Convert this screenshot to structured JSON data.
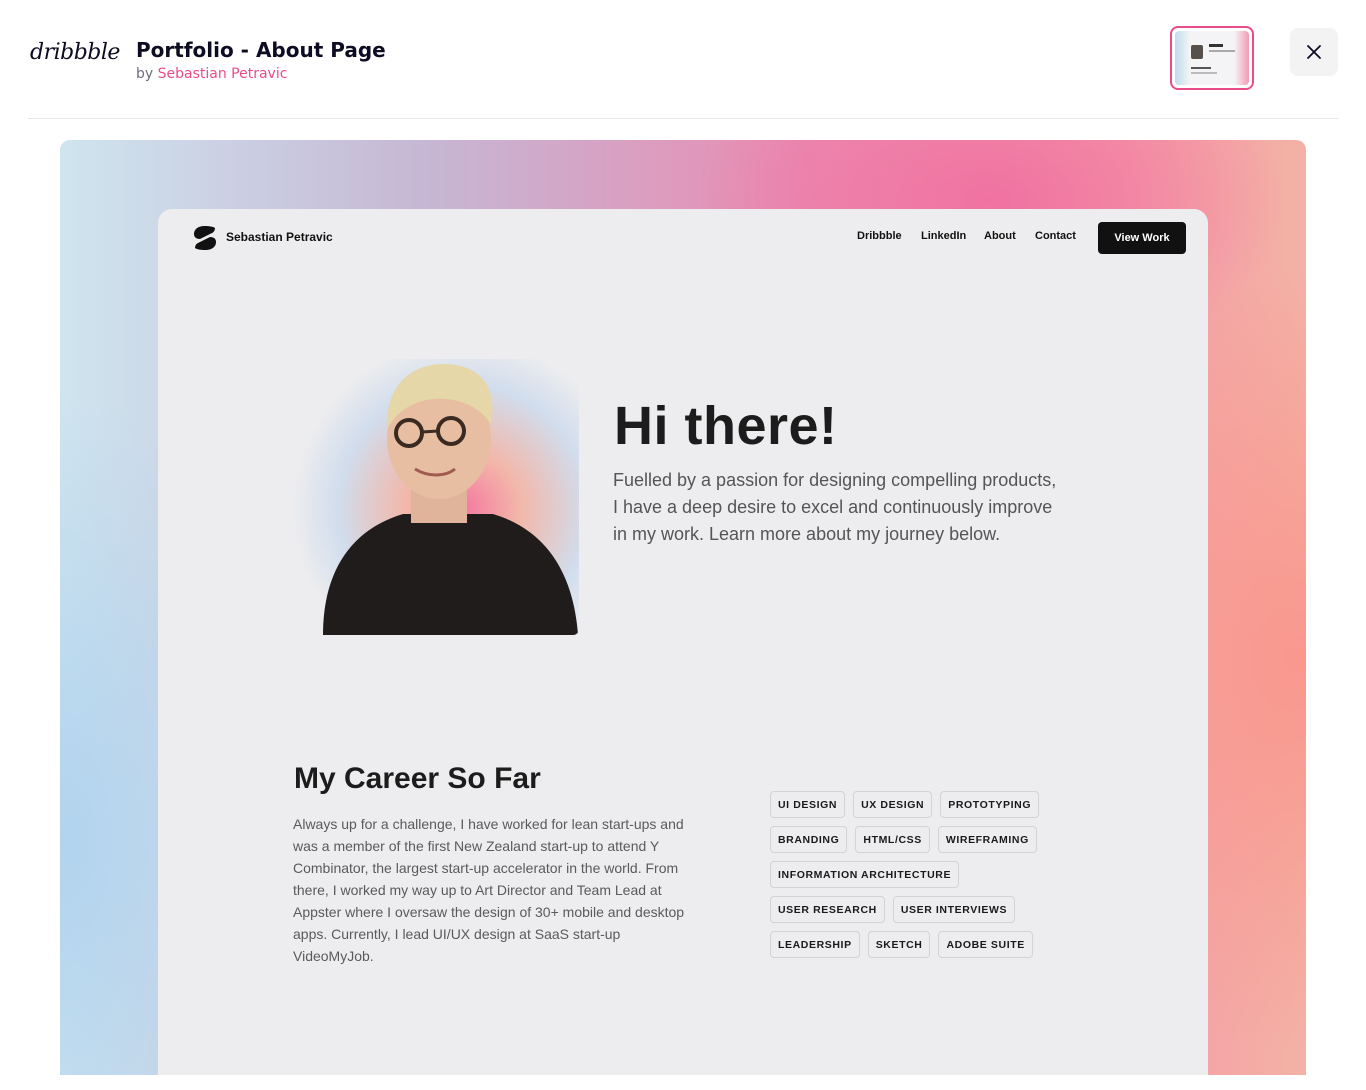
{
  "header": {
    "logo_text": "dribbble",
    "shot_title": "Portfolio - About Page",
    "by_prefix": "by",
    "author": "Sebastian Petravic"
  },
  "shot": {
    "site_name": "Sebastian Petravic",
    "nav": [
      "Dribbble",
      "LinkedIn",
      "About",
      "Contact"
    ],
    "cta": "View Work",
    "hero_title": "Hi there!",
    "hero_text": "Fuelled by a passion for designing compelling products, I have a deep desire to excel and continuously improve in my work. Learn more about my journey below.",
    "career_title": "My Career So Far",
    "career_text": "Always up for a challenge, I have worked for lean start-ups and was a member of the first New Zealand start-up to attend Y Combinator, the largest start-up accelerator in the world. From there, I worked my way up to Art Director and Team Lead at Appster where I oversaw the design of 30+ mobile and desktop apps. Currently, I lead UI/UX design at SaaS start-up VideoMyJob.",
    "tags": [
      [
        "UI DESIGN",
        "UX DESIGN",
        "PROTOTYPING"
      ],
      [
        "BRANDING",
        "HTML/CSS",
        "WIREFRAMING"
      ],
      [
        "INFORMATION ARCHITECTURE"
      ],
      [
        "USER RESEARCH",
        "USER INTERVIEWS"
      ],
      [
        "LEADERSHIP",
        "SKETCH",
        "ADOBE SUITE"
      ]
    ]
  },
  "colors": {
    "accent_pink": "#ea4c89",
    "ink": "#0d0c22"
  }
}
